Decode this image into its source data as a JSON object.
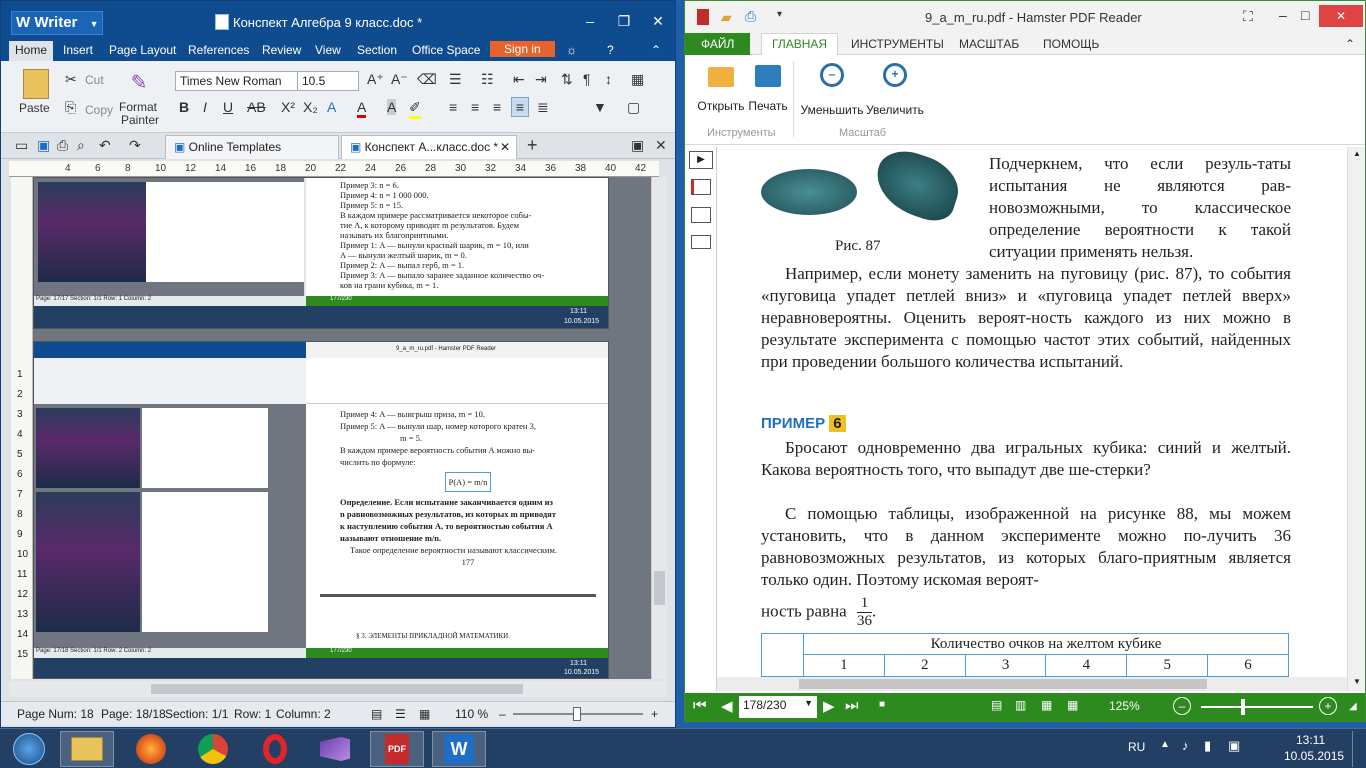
{
  "writer": {
    "app_name": "Writer",
    "doc_title": "Конспект Алгебра 9 класс.doc *",
    "menu": [
      "Home",
      "Insert",
      "Page Layout",
      "References",
      "Review",
      "View",
      "Section",
      "Office Space"
    ],
    "sign_in": "Sign in",
    "clipboard": {
      "paste": "Paste",
      "cut": "Cut",
      "copy": "Copy",
      "format_painter_1": "Format",
      "format_painter_2": "Painter"
    },
    "font": {
      "name": "Times New Roman",
      "size": "10.5"
    },
    "tabs": {
      "online_templates": "Online Templates",
      "doc_tab": "Конспект А...класс.doc *",
      "add": "+"
    },
    "ruler_marks": [
      "4",
      "6",
      "8",
      "10",
      "12",
      "14",
      "16",
      "18",
      "20",
      "22",
      "24",
      "26",
      "28",
      "30",
      "32",
      "34",
      "36",
      "38",
      "40",
      "42"
    ],
    "vruler_marks": [
      "1",
      "2",
      "3",
      "4",
      "5",
      "6",
      "7",
      "8",
      "9",
      "10",
      "11",
      "12",
      "13",
      "14",
      "15"
    ],
    "status": {
      "page_num": "Page Num: 18",
      "page": "Page: 18/18",
      "section": "Section: 1/1",
      "row": "Row: 1",
      "column": "Column: 2",
      "zoom": "110 %"
    },
    "embedded": {
      "top_text": [
        "Пример 3: n = 6.",
        "Пример 4: n = 1 000 000.",
        "Пример 5: n = 15.",
        "В каждом примере рассматривается некоторое собы-",
        "тие A, к которому приводят m результатов. Будем",
        "называть их благоприятными.",
        "Пример 1: A — вынули красный шарик, m = 10, или",
        "A — вынули желтый шарик, m = 0.",
        "Пример 2: A — выпал герб, m = 1.",
        "Пример 3: A — выпало заранее заданное количество оч-",
        "ков на грани кубика, m = 1."
      ],
      "bottom_text": [
        "Пример 4: A — выигрыш приза, m = 10.",
        "Пример 5: A — вынули шар, номер которого кратен 3,",
        "m = 5.",
        "В каждом примере вероятность события A можно вы-",
        "числить по формуле:",
        "P(A) = m/n",
        "Определение. Если испытание заканчивается одним из",
        "n равновозможных результатов, из которых m приводят",
        "к наступлению события A, то вероятностью события A",
        "называют отношение m/n.",
        "Такое определение вероятности называют классическим.",
        "177",
        "§ 3. ЭЛЕМЕНТЫ ПРИКЛАДНОЙ МАТЕМАТИКИ"
      ],
      "mini_pdf_title": "9_a_m_ru.pdf - Hamster PDF Reader",
      "mini_page": "177/230",
      "mini_page2": "177/230",
      "mini_time": "13:11",
      "mini_date": "10.05.2015",
      "mini_status1": "Page: 17/17  Section: 1/1  Row: 1  Column: 2",
      "mini_status2": "Page: 17/18  Section: 1/1  Row: 2  Column: 2"
    }
  },
  "pdf": {
    "title": "9_a_m_ru.pdf - Hamster PDF Reader",
    "menu": [
      "ФАЙЛ",
      "ГЛАВНАЯ",
      "ИНСТРУМЕНТЫ",
      "МАСШТАБ",
      "ПОМОЩЬ"
    ],
    "ribbon": {
      "open": "Открыть",
      "print": "Печать",
      "zoom_out": "Уменьшить",
      "zoom_in": "Увеличить",
      "group_tools": "Инструменты",
      "group_scale": "Масштаб"
    },
    "page": {
      "figure_caption": "Рис. 87",
      "para1": "Подчеркнем, что если резуль-таты испытания не являются рав-новозможными, то классическое определение вероятности к такой ситуации применять нельзя.",
      "para2": "Например, если монету заменить на пуговицу (рис. 87), то события «пуговица упадет петлей вниз» и «пуговица упадет петлей вверх» неравновероятны. Оценить вероят-ность каждого из них можно в результате эксперимента с помощью частот этих событий, найденных при проведении большого количества испытаний.",
      "example_label": "ПРИМЕР",
      "example_num": "6",
      "para3": "Бросают одновременно два игральных кубика: синий и желтый. Какова вероятность того, что выпадут две ше-стерки?",
      "para4": "С помощью таблицы, изображенной на рисунке 88, мы можем установить, что в данном эксперименте можно по-лучить 36 равновозможных результатов, из которых благо-приятным является только один. Поэтому искомая вероят-",
      "para4_end": "ность равна",
      "frac_num": "1",
      "frac_den": "36",
      "frac_dot": ".",
      "table_header": "Количество очков на желтом кубике",
      "table_cols": [
        "1",
        "2",
        "3",
        "4",
        "5",
        "6"
      ]
    },
    "nav": {
      "page": "178/230",
      "zoom": "125%"
    }
  },
  "taskbar": {
    "lang": "RU",
    "time": "13:11",
    "date": "10.05.2015"
  },
  "colors": {
    "writer_blue": "#0f4b8f",
    "pdf_green": "#2d8a1f",
    "accent_blue": "#1e6ec8",
    "signin": "#e8632b"
  }
}
